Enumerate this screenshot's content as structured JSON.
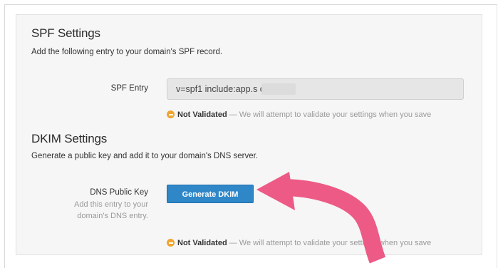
{
  "spf": {
    "title": "SPF Settings",
    "description": "Add the following entry to your domain's SPF record.",
    "entry_label": "SPF Entry",
    "entry_value": "v=spf1 include:app.s             com ~all",
    "status_label": "Not Validated",
    "status_text": " — We will attempt to validate your settings when you save"
  },
  "dkim": {
    "title": "DKIM Settings",
    "description": "Generate a public key and add it to your domain's DNS server.",
    "key_label": "DNS Public Key",
    "key_help_line1": "Add this entry to your",
    "key_help_line2": "domain's DNS entry.",
    "button_label": "Generate DKIM",
    "status_label": "Not Validated",
    "status_text": " — We will attempt to validate your settings when you save"
  },
  "colors": {
    "panel_bg": "#f6f6f6",
    "button_blue": "#2f87c8",
    "warning_orange": "#f0a531",
    "arrow_pink": "#ec5a85"
  }
}
